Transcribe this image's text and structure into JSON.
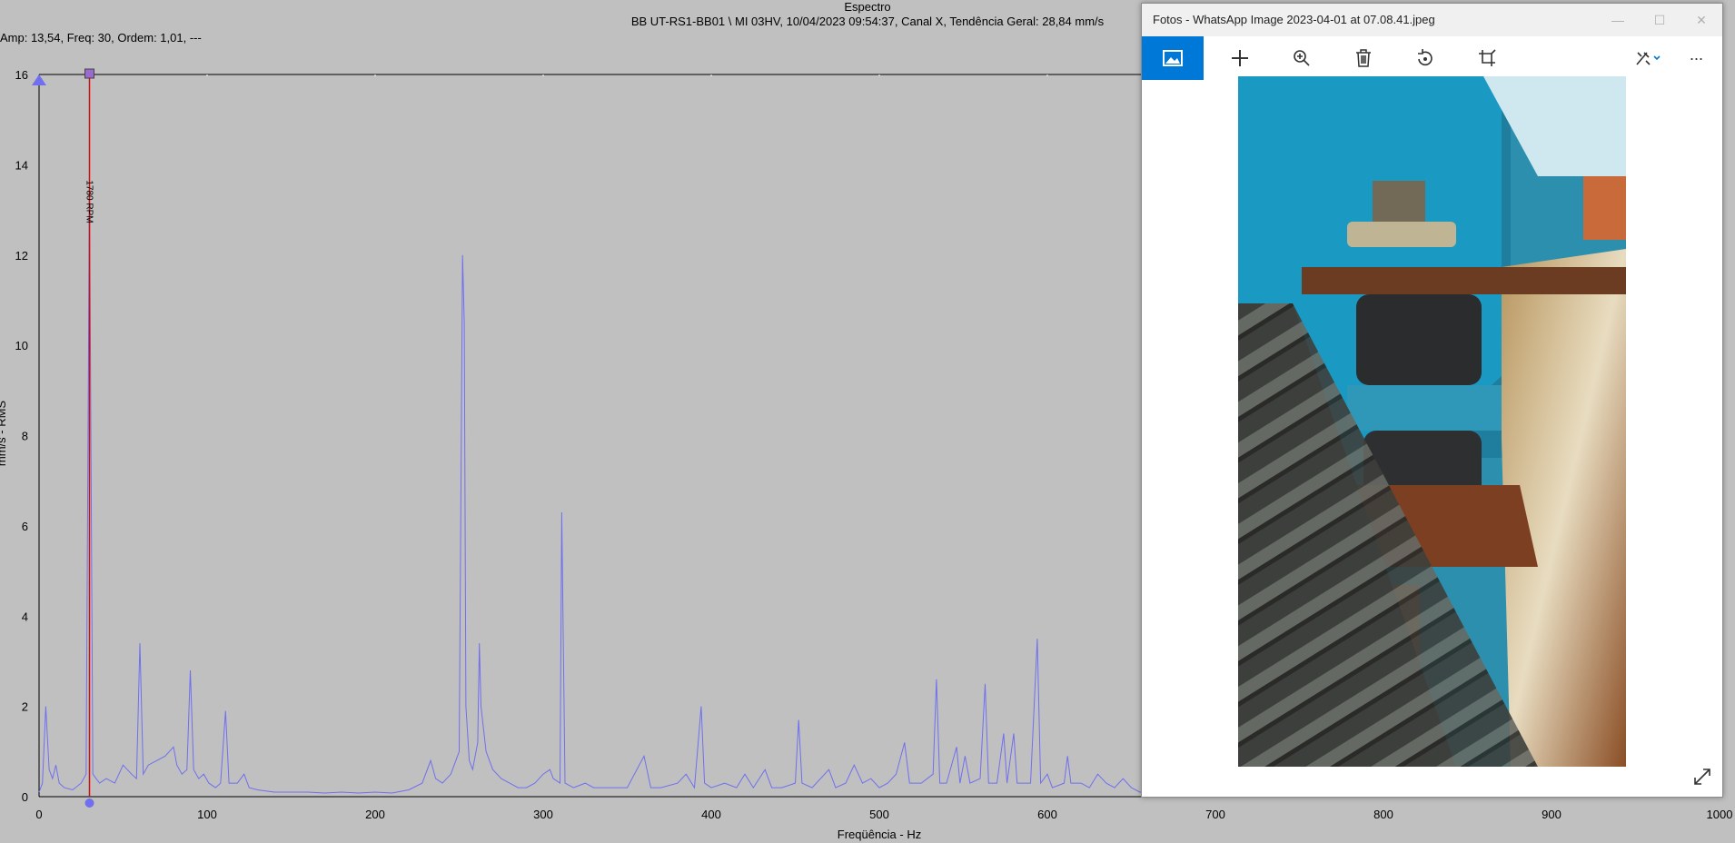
{
  "spectrum": {
    "title": "Espectro",
    "subtitle": "BB UT-RS1-BB01 \\ MI 03HV, 10/04/2023 09:54:37, Canal X, Tendência Geral: 28,84 mm/s",
    "readout": "Amp: 13,54, Freq: 30, Ordem: 1,01, ---",
    "cursor_label": "1780 RPM",
    "line_color": "#6f6ff0",
    "cursor_color": "#d01010"
  },
  "chart_data": {
    "type": "line",
    "xlabel": "Freqüência - Hz",
    "ylabel": "mm/s - RMS",
    "xlim": [
      0,
      1000
    ],
    "ylim": [
      0,
      16
    ],
    "x_ticks": [
      "0",
      "100",
      "200",
      "300",
      "400",
      "500",
      "600",
      "700",
      "800",
      "900",
      "1000"
    ],
    "y_ticks": [
      "0",
      "2",
      "4",
      "6",
      "8",
      "10",
      "12",
      "14",
      "16"
    ],
    "cursor_x": 30,
    "series": [
      {
        "values": [
          [
            0,
            0.1
          ],
          [
            2,
            0.3
          ],
          [
            4,
            2.0
          ],
          [
            6,
            0.6
          ],
          [
            8,
            0.4
          ],
          [
            10,
            0.7
          ],
          [
            12,
            0.3
          ],
          [
            15,
            0.2
          ],
          [
            20,
            0.15
          ],
          [
            25,
            0.3
          ],
          [
            28,
            0.5
          ],
          [
            30,
            13.54
          ],
          [
            32,
            0.5
          ],
          [
            36,
            0.3
          ],
          [
            40,
            0.4
          ],
          [
            45,
            0.3
          ],
          [
            50,
            0.7
          ],
          [
            55,
            0.5
          ],
          [
            58,
            0.4
          ],
          [
            60,
            3.4
          ],
          [
            62,
            0.5
          ],
          [
            65,
            0.7
          ],
          [
            70,
            0.8
          ],
          [
            75,
            0.9
          ],
          [
            80,
            1.1
          ],
          [
            82,
            0.7
          ],
          [
            85,
            0.5
          ],
          [
            88,
            0.6
          ],
          [
            90,
            2.8
          ],
          [
            92,
            0.6
          ],
          [
            95,
            0.4
          ],
          [
            98,
            0.5
          ],
          [
            101,
            0.3
          ],
          [
            105,
            0.2
          ],
          [
            108,
            0.3
          ],
          [
            111,
            1.9
          ],
          [
            113,
            0.3
          ],
          [
            118,
            0.3
          ],
          [
            122,
            0.5
          ],
          [
            125,
            0.2
          ],
          [
            130,
            0.15
          ],
          [
            140,
            0.1
          ],
          [
            150,
            0.1
          ],
          [
            160,
            0.1
          ],
          [
            170,
            0.08
          ],
          [
            180,
            0.1
          ],
          [
            190,
            0.08
          ],
          [
            200,
            0.1
          ],
          [
            210,
            0.08
          ],
          [
            220,
            0.15
          ],
          [
            228,
            0.3
          ],
          [
            233,
            0.8
          ],
          [
            236,
            0.4
          ],
          [
            240,
            0.3
          ],
          [
            245,
            0.5
          ],
          [
            250,
            1.0
          ],
          [
            252,
            12.0
          ],
          [
            253,
            10.5
          ],
          [
            254,
            2.0
          ],
          [
            256,
            0.8
          ],
          [
            258,
            0.6
          ],
          [
            261,
            1.2
          ],
          [
            262,
            3.4
          ],
          [
            263,
            2.0
          ],
          [
            266,
            1.0
          ],
          [
            270,
            0.6
          ],
          [
            275,
            0.4
          ],
          [
            280,
            0.3
          ],
          [
            285,
            0.2
          ],
          [
            290,
            0.2
          ],
          [
            295,
            0.3
          ],
          [
            300,
            0.5
          ],
          [
            304,
            0.6
          ],
          [
            306,
            0.4
          ],
          [
            310,
            0.3
          ],
          [
            311,
            6.3
          ],
          [
            313,
            0.3
          ],
          [
            318,
            0.2
          ],
          [
            325,
            0.3
          ],
          [
            330,
            0.2
          ],
          [
            340,
            0.2
          ],
          [
            350,
            0.2
          ],
          [
            360,
            0.9
          ],
          [
            364,
            0.2
          ],
          [
            370,
            0.2
          ],
          [
            380,
            0.3
          ],
          [
            385,
            0.5
          ],
          [
            390,
            0.2
          ],
          [
            394,
            2.0
          ],
          [
            396,
            0.3
          ],
          [
            400,
            0.2
          ],
          [
            408,
            0.3
          ],
          [
            415,
            0.2
          ],
          [
            420,
            0.5
          ],
          [
            425,
            0.2
          ],
          [
            432,
            0.6
          ],
          [
            436,
            0.2
          ],
          [
            442,
            0.2
          ],
          [
            450,
            0.3
          ],
          [
            452,
            1.7
          ],
          [
            454,
            0.3
          ],
          [
            460,
            0.2
          ],
          [
            470,
            0.6
          ],
          [
            474,
            0.2
          ],
          [
            480,
            0.3
          ],
          [
            485,
            0.7
          ],
          [
            490,
            0.3
          ],
          [
            495,
            0.4
          ],
          [
            500,
            0.2
          ],
          [
            505,
            0.3
          ],
          [
            510,
            0.5
          ],
          [
            515,
            1.2
          ],
          [
            518,
            0.3
          ],
          [
            525,
            0.3
          ],
          [
            532,
            0.5
          ],
          [
            534,
            2.6
          ],
          [
            536,
            0.3
          ],
          [
            540,
            0.3
          ],
          [
            546,
            1.1
          ],
          [
            548,
            0.3
          ],
          [
            551,
            0.9
          ],
          [
            554,
            0.3
          ],
          [
            560,
            0.4
          ],
          [
            563,
            2.5
          ],
          [
            565,
            0.3
          ],
          [
            570,
            0.3
          ],
          [
            574,
            1.4
          ],
          [
            576,
            0.3
          ],
          [
            580,
            1.4
          ],
          [
            582,
            0.3
          ],
          [
            586,
            0.3
          ],
          [
            590,
            0.3
          ],
          [
            594,
            3.5
          ],
          [
            596,
            0.3
          ],
          [
            600,
            0.5
          ],
          [
            603,
            0.2
          ],
          [
            610,
            0.3
          ],
          [
            612,
            0.9
          ],
          [
            614,
            0.3
          ],
          [
            620,
            0.3
          ],
          [
            625,
            0.2
          ],
          [
            630,
            0.5
          ],
          [
            635,
            0.3
          ],
          [
            640,
            0.2
          ],
          [
            645,
            0.4
          ],
          [
            650,
            0.2
          ],
          [
            655,
            0.1
          ],
          [
            660,
            0.1
          ]
        ]
      }
    ]
  },
  "photos": {
    "window_title": "Fotos - WhatsApp Image 2023-04-01 at 07.08.41.jpeg",
    "minimize_glyph": "—",
    "maximize_glyph": "☐",
    "close_glyph": "✕",
    "more_glyph": "···"
  }
}
